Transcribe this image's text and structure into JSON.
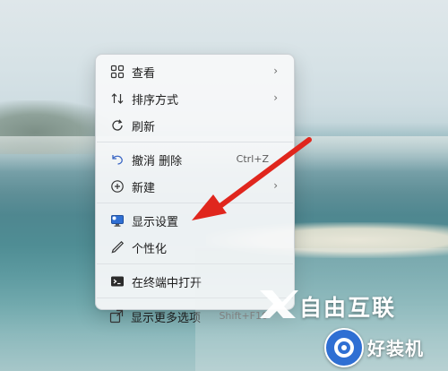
{
  "context_menu": {
    "items": [
      {
        "label": "查看",
        "icon": "grid-view-icon",
        "submenu": true
      },
      {
        "label": "排序方式",
        "icon": "sort-icon",
        "submenu": true
      },
      {
        "label": "刷新",
        "icon": "refresh-icon"
      },
      {
        "label": "撤消 删除",
        "icon": "undo-icon",
        "shortcut": "Ctrl+Z"
      },
      {
        "label": "新建",
        "icon": "new-plus-icon",
        "submenu": true
      },
      {
        "label": "显示设置",
        "icon": "display-settings-icon"
      },
      {
        "label": "个性化",
        "icon": "pen-brush-icon"
      },
      {
        "label": "在终端中打开",
        "icon": "terminal-icon"
      },
      {
        "label": "显示更多选项",
        "icon": "more-options-icon",
        "shortcut": "Shift+F10"
      }
    ]
  },
  "watermarks": {
    "primary": "自由互联",
    "secondary": "好装机"
  },
  "colors": {
    "arrow": "#e0261d",
    "menu_bg": "#f6f8f9",
    "accent": "#1f6fd0"
  }
}
